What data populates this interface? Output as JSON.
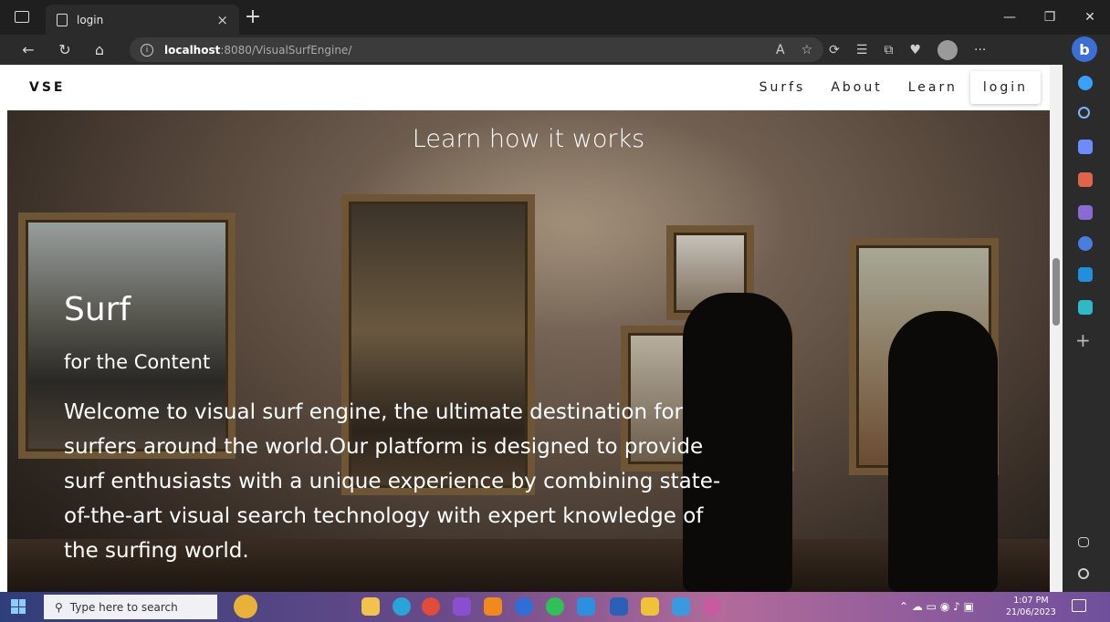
{
  "browser": {
    "tab_title": "login",
    "tab_close": "×",
    "new_tab": "+",
    "url_host": "localhost",
    "url_rest": ":8080/VisualSurfEngine/"
  },
  "site": {
    "brand": "VSE",
    "nav": [
      "Surfs",
      "About",
      "Learn"
    ],
    "login_label": "login"
  },
  "hero": {
    "title": "Learn how it works",
    "heading": "Surf",
    "subheading": "for the Content",
    "body": "Welcome to visual surf engine, the ultimate destination for surfers around the world.Our platform is designed to provide surf enthusiasts with a unique experience by combining state-of-the-art visual search technology with expert knowledge of the surfing world."
  },
  "taskbar": {
    "search_placeholder": "Type here to search",
    "time": "1:07 PM",
    "date": "21/06/2023"
  },
  "colors": {
    "chrome_dark": "#1f1f1f",
    "chrome_mid": "#2b2b2b",
    "edge_blue": "#3c6fd6"
  }
}
